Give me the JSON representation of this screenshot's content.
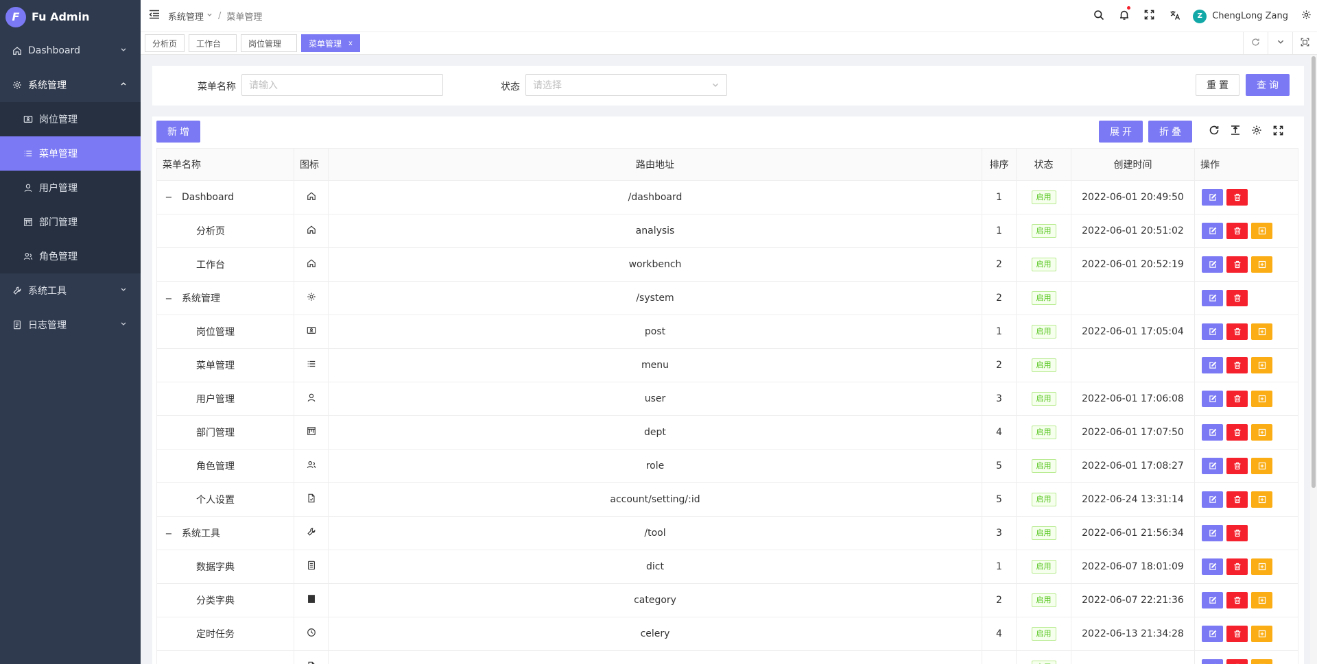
{
  "app": {
    "title": "Fu Admin",
    "logo_letter": "F"
  },
  "sidebar": {
    "items": [
      {
        "label": "Dashboard",
        "icon": "home-icon",
        "expanded": false
      },
      {
        "label": "系统管理",
        "icon": "gear-icon",
        "expanded": true,
        "children": [
          {
            "label": "岗位管理",
            "icon": "id-card-icon"
          },
          {
            "label": "菜单管理",
            "icon": "list-icon",
            "active": true
          },
          {
            "label": "用户管理",
            "icon": "user-icon"
          },
          {
            "label": "部门管理",
            "icon": "dept-icon"
          },
          {
            "label": "角色管理",
            "icon": "role-icon"
          }
        ]
      },
      {
        "label": "系统工具",
        "icon": "wrench-icon",
        "expanded": false
      },
      {
        "label": "日志管理",
        "icon": "log-icon",
        "expanded": false
      }
    ]
  },
  "header": {
    "breadcrumb": [
      "系统管理",
      "菜单管理"
    ],
    "user_name": "ChengLong Zang",
    "avatar_letter": "Z"
  },
  "tabs": [
    {
      "label": "分析页"
    },
    {
      "label": "工作台"
    },
    {
      "label": "岗位管理"
    },
    {
      "label": "菜单管理",
      "active": true,
      "close": "x"
    }
  ],
  "search": {
    "menu_name_label": "菜单名称",
    "menu_name_placeholder": "请输入",
    "status_label": "状态",
    "status_placeholder": "请选择",
    "reset_label": "重置",
    "query_label": "查询"
  },
  "toolbar": {
    "add_label": "新增",
    "expand_label": "展开",
    "collapse_label": "折叠"
  },
  "table": {
    "columns": [
      "菜单名称",
      "图标",
      "路由地址",
      "排序",
      "状态",
      "创建时间",
      "操作"
    ],
    "rows": [
      {
        "name": "Dashboard",
        "level": 0,
        "toggle": "−",
        "icon": "home-icon",
        "path": "/dashboard",
        "sort": "1",
        "status": "启用",
        "created": "2022-06-01 20:49:50",
        "ops": [
          "edit",
          "delete"
        ]
      },
      {
        "name": "分析页",
        "level": 1,
        "icon": "home-icon",
        "path": "analysis",
        "sort": "1",
        "status": "启用",
        "created": "2022-06-01 20:51:02",
        "ops": [
          "edit",
          "delete",
          "add"
        ]
      },
      {
        "name": "工作台",
        "level": 1,
        "icon": "home-icon",
        "path": "workbench",
        "sort": "2",
        "status": "启用",
        "created": "2022-06-01 20:52:19",
        "ops": [
          "edit",
          "delete",
          "add"
        ]
      },
      {
        "name": "系统管理",
        "level": 0,
        "toggle": "−",
        "icon": "gear-icon",
        "path": "/system",
        "sort": "2",
        "status": "启用",
        "created": "",
        "ops": [
          "edit",
          "delete"
        ]
      },
      {
        "name": "岗位管理",
        "level": 1,
        "icon": "id-card-icon",
        "path": "post",
        "sort": "1",
        "status": "启用",
        "created": "2022-06-01 17:05:04",
        "ops": [
          "edit",
          "delete",
          "add"
        ]
      },
      {
        "name": "菜单管理",
        "level": 1,
        "icon": "list-icon",
        "path": "menu",
        "sort": "2",
        "status": "启用",
        "created": "",
        "ops": [
          "edit",
          "delete",
          "add"
        ]
      },
      {
        "name": "用户管理",
        "level": 1,
        "icon": "user-icon",
        "path": "user",
        "sort": "3",
        "status": "启用",
        "created": "2022-06-01 17:06:08",
        "ops": [
          "edit",
          "delete",
          "add"
        ]
      },
      {
        "name": "部门管理",
        "level": 1,
        "icon": "dept-icon",
        "path": "dept",
        "sort": "4",
        "status": "启用",
        "created": "2022-06-01 17:07:50",
        "ops": [
          "edit",
          "delete",
          "add"
        ]
      },
      {
        "name": "角色管理",
        "level": 1,
        "icon": "role-icon",
        "path": "role",
        "sort": "5",
        "status": "启用",
        "created": "2022-06-01 17:08:27",
        "ops": [
          "edit",
          "delete",
          "add"
        ]
      },
      {
        "name": "个人设置",
        "level": 1,
        "icon": "file-icon",
        "path": "account/setting/:id",
        "sort": "5",
        "status": "启用",
        "created": "2022-06-24 13:31:14",
        "ops": [
          "edit",
          "delete",
          "add"
        ]
      },
      {
        "name": "系统工具",
        "level": 0,
        "toggle": "−",
        "icon": "wrench-icon",
        "path": "/tool",
        "sort": "3",
        "status": "启用",
        "created": "2022-06-01 21:56:34",
        "ops": [
          "edit",
          "delete"
        ]
      },
      {
        "name": "数据字典",
        "level": 1,
        "icon": "book-icon",
        "path": "dict",
        "sort": "1",
        "status": "启用",
        "created": "2022-06-07 18:01:09",
        "ops": [
          "edit",
          "delete",
          "add"
        ]
      },
      {
        "name": "分类字典",
        "level": 1,
        "icon": "database-icon",
        "path": "category",
        "sort": "2",
        "status": "启用",
        "created": "2022-06-07 22:21:36",
        "ops": [
          "edit",
          "delete",
          "add"
        ]
      },
      {
        "name": "定时任务",
        "level": 1,
        "icon": "clock-icon",
        "path": "celery",
        "sort": "4",
        "status": "启用",
        "created": "2022-06-13 21:34:28",
        "ops": [
          "edit",
          "delete",
          "add"
        ]
      },
      {
        "name": "",
        "level": 1,
        "icon": "file-icon",
        "path": "",
        "sort": "",
        "status": "启用",
        "created": "",
        "ops": [
          "edit",
          "delete",
          "add"
        ]
      }
    ]
  },
  "colors": {
    "primary": "#7b79f4",
    "danger": "#f5222d",
    "warning": "#faad14",
    "sidebar": "#2f3a4e",
    "success": "#52c41a"
  }
}
